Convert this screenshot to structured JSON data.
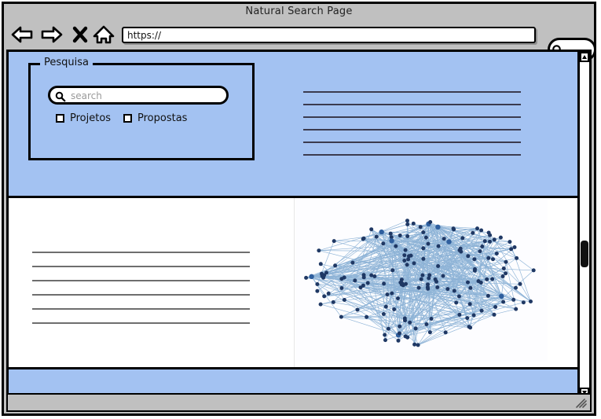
{
  "window": {
    "title": "Natural Search Page"
  },
  "toolbar": {
    "back_icon": "back-arrow-icon",
    "forward_icon": "forward-arrow-icon",
    "stop_label": "X",
    "stop_icon": "close-x-icon",
    "home_icon": "home-icon",
    "url_value": "https://",
    "url_placeholder": "https://",
    "browser_search_icon": "search-icon",
    "browser_search_value": ""
  },
  "page": {
    "search_panel": {
      "legend": "Pesquisa",
      "search_icon": "search-icon",
      "search_value": "",
      "search_placeholder": "search",
      "checkboxes": [
        {
          "label": "Projetos",
          "checked": false
        },
        {
          "label": "Propostas",
          "checked": false
        }
      ]
    },
    "header_lines": {
      "count": 6
    },
    "body_lines": {
      "count": 6
    },
    "graph": {
      "title": "network-graph",
      "node_color": "#1f3864",
      "edge_color": "#7ba7d0",
      "background": "#fdfdff"
    }
  },
  "scrollbar": {
    "up_arrow": "chevron-up-icon",
    "down_arrow": "chevron-down-icon",
    "thumb_position_percent": 56
  },
  "status_bar": {
    "text": "",
    "resize_grip_icon": "resize-grip-icon"
  },
  "colors": {
    "chrome": "#c0c0c0",
    "panel_blue": "#a3c2f2",
    "outline": "#000000",
    "node": "#1f3864",
    "edge": "#7ba7d0"
  }
}
